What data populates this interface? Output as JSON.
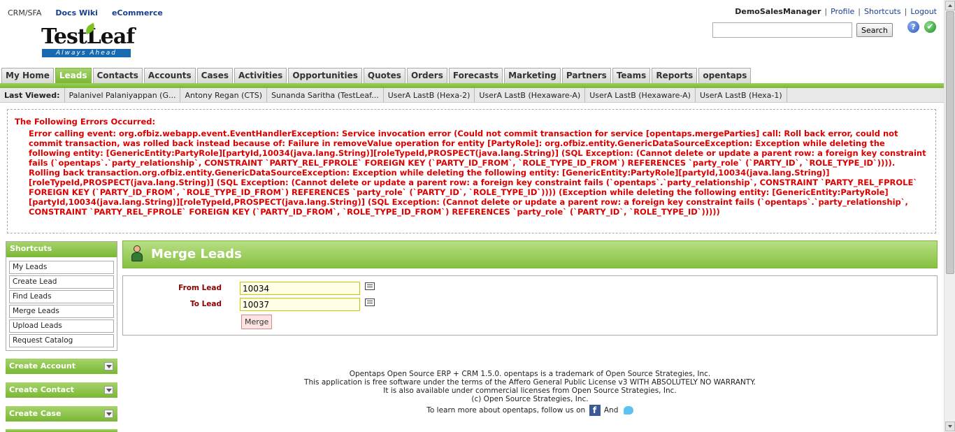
{
  "top_links": {
    "crm": "CRM/SFA",
    "docs": "Docs Wiki",
    "ecommerce": "eCommerce"
  },
  "user_bar": {
    "user": "DemoSalesManager",
    "profile": "Profile",
    "shortcuts": "Shortcuts",
    "logout": "Logout",
    "sep": "|"
  },
  "search": {
    "value": "",
    "button": "Search"
  },
  "header_icons": {
    "help": "?",
    "ok": "✔"
  },
  "logo": {
    "text": "TestLeaf",
    "tagline": "Always Ahead"
  },
  "tabs": [
    "My Home",
    "Leads",
    "Contacts",
    "Accounts",
    "Cases",
    "Activities",
    "Opportunities",
    "Quotes",
    "Orders",
    "Forecasts",
    "Marketing",
    "Partners",
    "Teams",
    "Reports",
    "opentaps"
  ],
  "active_tab": "Leads",
  "last_viewed": {
    "label": "Last Viewed:",
    "items": [
      "Palanivel Palaniyappan (G...",
      "Antony Regan (CTS)",
      "Sunanda Saritha (TestLeaf...",
      "UserA LastB (Hexa-2)",
      "UserA LastB (Hexaware-A)",
      "UserA LastB (Hexaware-A)",
      "UserA LastB (Hexa-1)"
    ]
  },
  "errors": {
    "title": "The Following Errors Occurred:",
    "message": "Error calling event: org.ofbiz.webapp.event.EventHandlerException: Service invocation error (Could not commit transaction for service [opentaps.mergeParties] call: Roll back error, could not commit transaction, was rolled back instead because of: Failure in removeValue operation for entity [PartyRole]: org.ofbiz.entity.GenericDataSourceException: Exception while deleting the following entity: [GenericEntity:PartyRole][partyId,10034(java.lang.String)][roleTypeId,PROSPECT(java.lang.String)] (SQL Exception: (Cannot delete or update a parent row: a foreign key constraint fails (`opentaps`.`party_relationship`, CONSTRAINT `PARTY_REL_FPROLE` FOREIGN KEY (`PARTY_ID_FROM`, `ROLE_TYPE_ID_FROM`) REFERENCES `party_role` (`PARTY_ID`, `ROLE_TYPE_ID`)))). Rolling back transaction.org.ofbiz.entity.GenericDataSourceException: Exception while deleting the following entity: [GenericEntity:PartyRole][partyId,10034(java.lang.String)][roleTypeId,PROSPECT(java.lang.String)] (SQL Exception: (Cannot delete or update a parent row: a foreign key constraint fails (`opentaps`.`party_relationship`, CONSTRAINT `PARTY_REL_FPROLE` FOREIGN KEY (`PARTY_ID_FROM`, `ROLE_TYPE_ID_FROM`) REFERENCES `party_role` (`PARTY_ID`, `ROLE_TYPE_ID`)))) (Exception while deleting the following entity: [GenericEntity:PartyRole][partyId,10034(java.lang.String)][roleTypeId,PROSPECT(java.lang.String)] (SQL Exception: (Cannot delete or update a parent row: a foreign key constraint fails (`opentaps`.`party_relationship`, CONSTRAINT `PARTY_REL_FPROLE` FOREIGN KEY (`PARTY_ID_FROM`, `ROLE_TYPE_ID_FROM`) REFERENCES `party_role` (`PARTY_ID`, `ROLE_TYPE_ID`)))))"
  },
  "shortcuts": {
    "title": "Shortcuts",
    "items": [
      "My Leads",
      "Create Lead",
      "Find Leads",
      "Merge Leads",
      "Upload Leads",
      "Request Catalog"
    ]
  },
  "collapsibles": [
    "Create Account",
    "Create Contact",
    "Create Case"
  ],
  "main": {
    "title": "Merge Leads",
    "from_label": "From Lead",
    "from_value": "10034",
    "to_label": "To Lead",
    "to_value": "10037",
    "merge_button": "Merge"
  },
  "footer": {
    "line1": "Opentaps Open Source ERP + CRM 1.5.0. opentaps is a trademark of Open Source Strategies, Inc.",
    "line2": "This application is free software under the terms of the Affero General Public License v3 WITH ABSOLUTELY NO WARRANTY.",
    "line3": "It is also available under commercial licenses from Open Source Strategies, Inc.",
    "line4": "(c) Open Source Strategies, Inc.",
    "line5": "To learn more about opentaps, follow us on",
    "and": "And",
    "fb": "f"
  },
  "colors": {
    "accent_green": "#7ab835",
    "error_red": "#dd0000",
    "link_blue": "#1a3f8c"
  }
}
